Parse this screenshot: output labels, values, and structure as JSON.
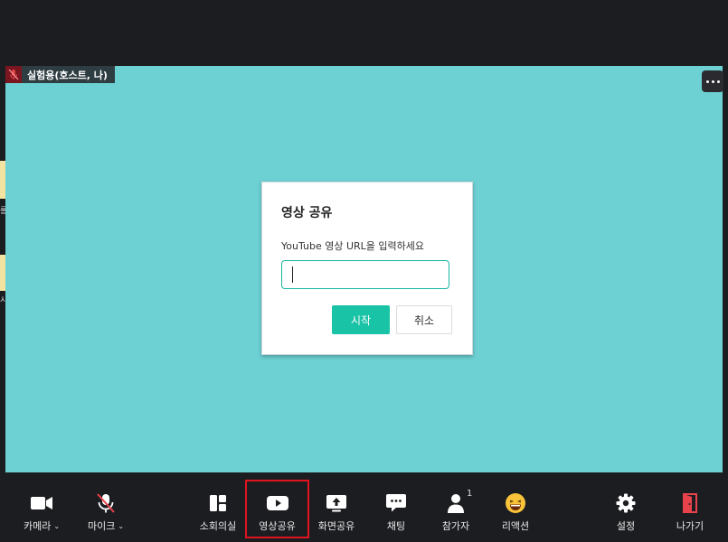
{
  "participant": {
    "name": "실험용(호스트, 나)"
  },
  "side_glyphs": [
    "를",
    "시"
  ],
  "dialog": {
    "title": "영상 공유",
    "prompt": "YouTube 영상 URL을 입력하세요",
    "input_value": "",
    "start_label": "시작",
    "cancel_label": "취소"
  },
  "toolbar": {
    "camera": "카메라",
    "mic": "마이크",
    "breakout": "소회의실",
    "video_share": "영상공유",
    "screen_share": "화면공유",
    "chat": "채팅",
    "participants": "참가자",
    "participant_count": "1",
    "reactions": "리액션",
    "settings": "설정",
    "leave": "나가기"
  },
  "colors": {
    "stage": "#6dd0d3",
    "accent": "#19c3a6",
    "leave": "#e8434a",
    "highlight": "#e0141f"
  }
}
